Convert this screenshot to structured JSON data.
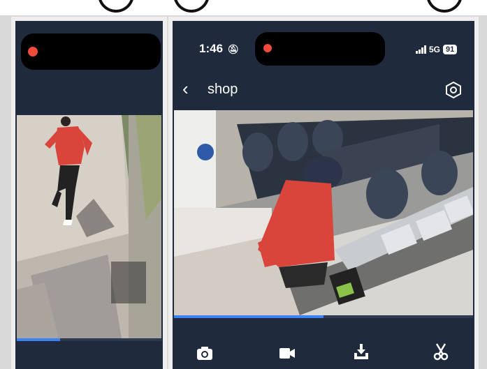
{
  "status_bar": {
    "time": "1:46",
    "network": "5G",
    "battery": "91"
  },
  "nav": {
    "title": "shop"
  },
  "left_video": {
    "progress": 0.3
  },
  "right_video": {
    "progress": 0.5
  },
  "toolbar": {
    "icons": [
      "camera-icon",
      "video-record-icon",
      "download-icon",
      "scissors-icon"
    ]
  },
  "colors": {
    "background": "#1f2a3d",
    "accent": "#3b82f6",
    "record": "#f04a3a"
  }
}
